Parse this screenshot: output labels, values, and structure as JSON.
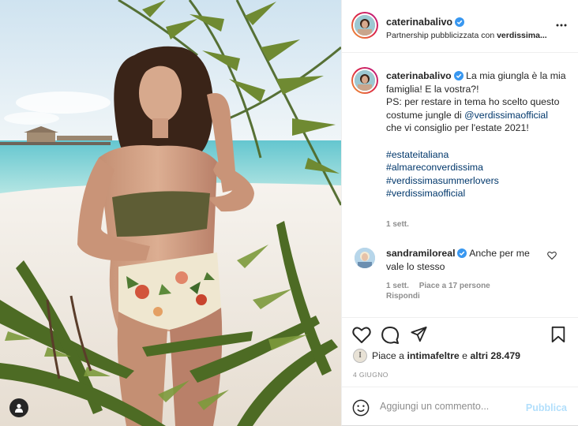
{
  "post": {
    "username": "caterinabalivo",
    "partnership_prefix": "Partnership pubblicizzata con ",
    "partner": "verdissima...",
    "more_icon": "more-horizontal-icon"
  },
  "caption": {
    "username": "caterinabalivo",
    "text_1": "La mia giungla è la mia famiglia! E la vostra?!",
    "text_2": "PS: per restare in tema ho scelto questo costume jungle di ",
    "mention": "@verdissimaofficial",
    "text_3": " che vi consiglio per l'estate 2021!",
    "hashtags": [
      "#estateitaliana",
      "#almareconverdissima",
      "#verdissimasummerlovers",
      "#verdissimaofficial"
    ],
    "time": "1 sett."
  },
  "comment": {
    "username": "sandramiloreal",
    "text": "Anche per me vale lo stesso",
    "time": "1 sett.",
    "likes": "Piace a 17 persone",
    "reply": "Rispondi"
  },
  "likes": {
    "prefix": "Piace a ",
    "user": "intimafeltre",
    "middle": " e ",
    "others": "altri 28.479",
    "avatar_letter": "I"
  },
  "date": "4 GIUGNO",
  "composer": {
    "placeholder": "Aggiungi un commento...",
    "publish": "Pubblica"
  },
  "colors": {
    "verified": "#3897f0",
    "link": "#00376b",
    "publish_disabled": "#b2dffc"
  }
}
